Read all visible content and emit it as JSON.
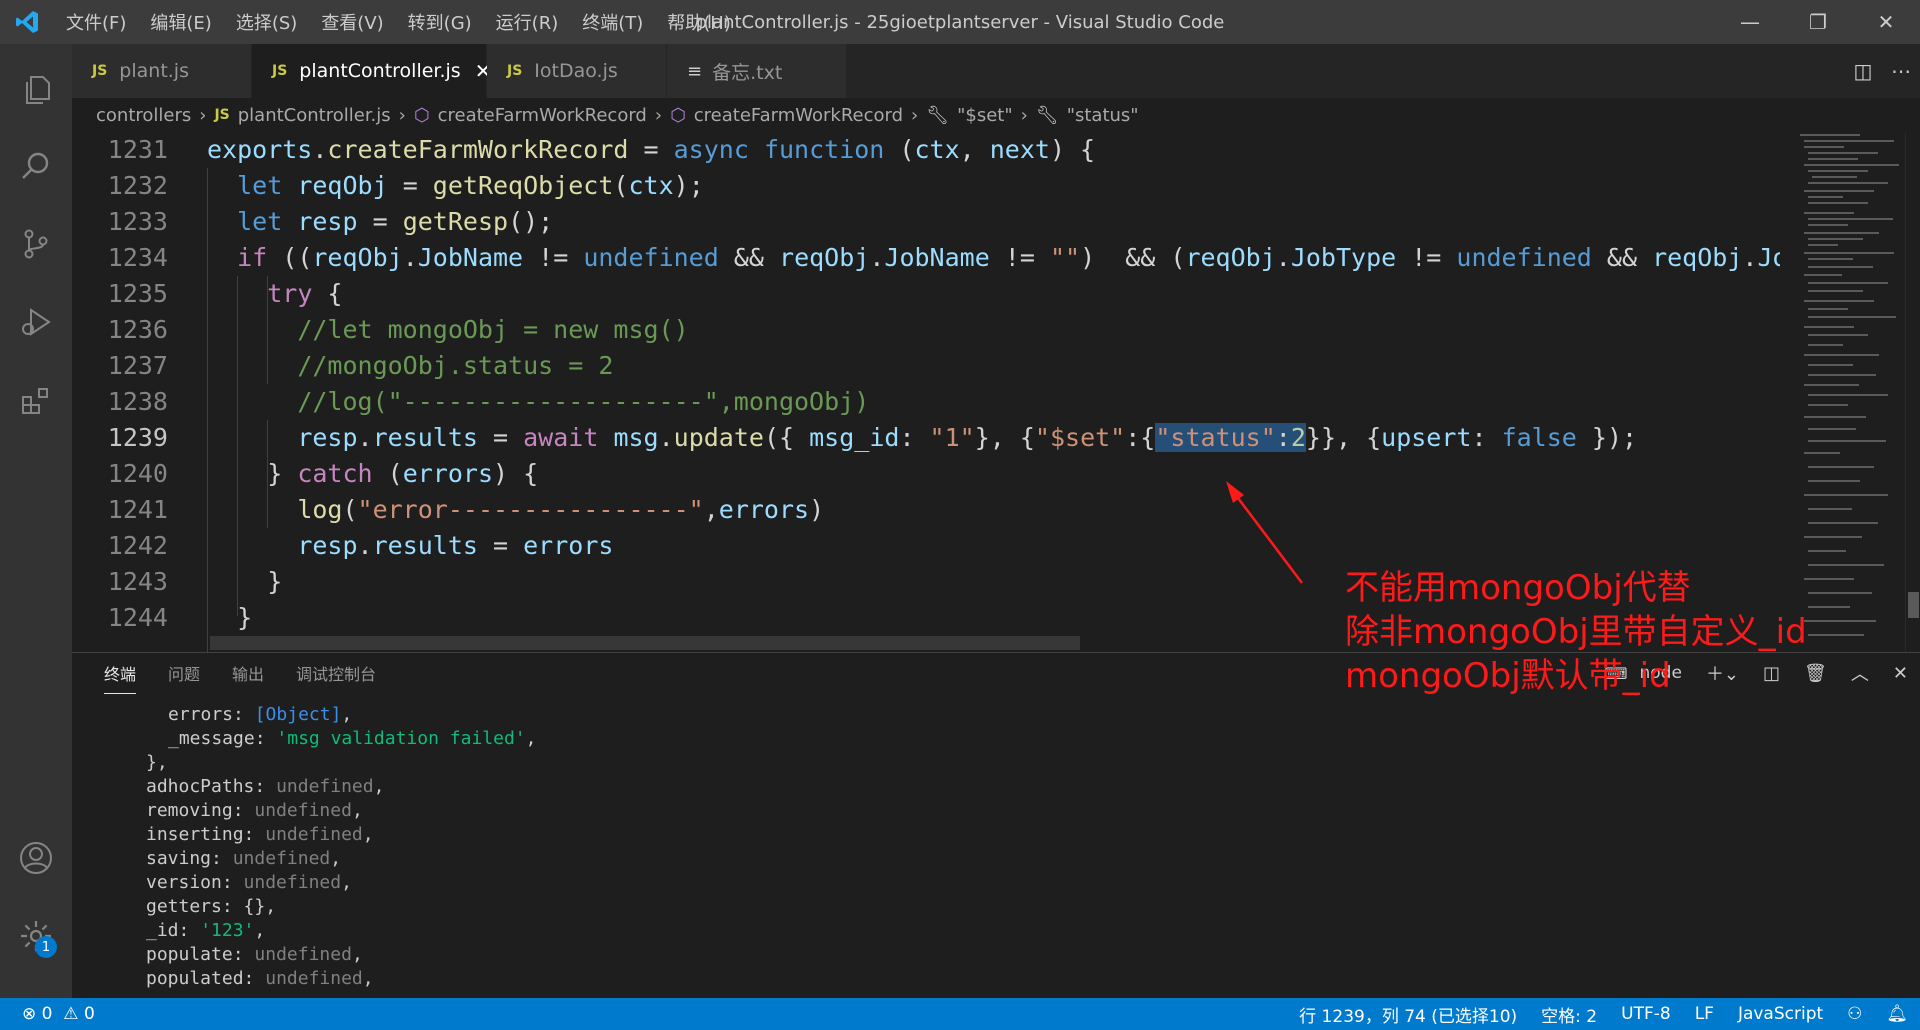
{
  "window": {
    "title": "plantController.js - 25gioetplantserver - Visual Studio Code"
  },
  "menu": [
    "文件(F)",
    "编辑(E)",
    "选择(S)",
    "查看(V)",
    "转到(G)",
    "运行(R)",
    "终端(T)",
    "帮助(H)"
  ],
  "tabs": [
    {
      "label": "plant.js"
    },
    {
      "label": "plantController.js"
    },
    {
      "label": "IotDao.js"
    },
    {
      "label": "备忘.txt"
    }
  ],
  "breadcrumb": [
    "controllers",
    "plantController.js",
    "createFarmWorkRecord",
    "createFarmWorkRecord",
    "\"$set\"",
    "\"status\""
  ],
  "editor": {
    "line_numbers": [
      "1231",
      "1232",
      "1233",
      "1234",
      "1235",
      "1236",
      "1237",
      "1238",
      "1239",
      "1240",
      "1241",
      "1242",
      "1243",
      "1244"
    ]
  },
  "panel": {
    "tabs": [
      "终端",
      "问题",
      "输出",
      "调试控制台"
    ],
    "shell": "node",
    "lines": [
      {
        "indent": 2,
        "key": "errors",
        "val": "[Object]",
        "type": "obj"
      },
      {
        "indent": 2,
        "key": "_message",
        "val": "'msg validation failed'",
        "type": "str"
      },
      {
        "indent": 1,
        "key": "",
        "val": "},",
        "type": "plain"
      },
      {
        "indent": 1,
        "key": "adhocPaths",
        "val": "undefined",
        "type": "und"
      },
      {
        "indent": 1,
        "key": "removing",
        "val": "undefined",
        "type": "und"
      },
      {
        "indent": 1,
        "key": "inserting",
        "val": "undefined",
        "type": "und"
      },
      {
        "indent": 1,
        "key": "saving",
        "val": "undefined",
        "type": "und"
      },
      {
        "indent": 1,
        "key": "version",
        "val": "undefined",
        "type": "und"
      },
      {
        "indent": 1,
        "key": "getters",
        "val": "{}",
        "type": "plain"
      },
      {
        "indent": 1,
        "key": "_id",
        "val": "'123'",
        "type": "str"
      },
      {
        "indent": 1,
        "key": "populate",
        "val": "undefined",
        "type": "und"
      },
      {
        "indent": 1,
        "key": "populated",
        "val": "undefined",
        "type": "und"
      }
    ]
  },
  "status": {
    "errors": "0",
    "warnings": "0",
    "position": "行 1239，列 74 (已选择10)",
    "spaces": "空格: 2",
    "encoding": "UTF-8",
    "eol": "LF",
    "language": "JavaScript",
    "accent": "#007acc"
  },
  "annotation": {
    "lines": [
      "不能用mongoObj代替",
      "除非mongoObj里带自定义_id",
      "mongoObj默认带_id"
    ],
    "color": "#ff1a1a"
  },
  "activity_badge": "1"
}
